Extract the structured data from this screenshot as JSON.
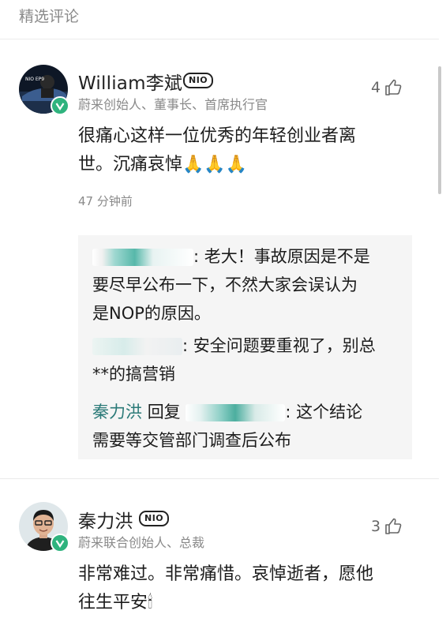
{
  "section_title": "精选评论",
  "comments": [
    {
      "username": "William李斌",
      "badge": "NIO",
      "title": "蔚来创始人、董事长、首席执行官",
      "likes": "4",
      "text_line1": "很痛心这样一位优秀的年轻创业者离",
      "text_line2": "世。沉痛哀悼🙏🙏🙏",
      "time": "47 分钟前",
      "replies": [
        {
          "text_line1": ": 老大！事故原因是不是",
          "text_line2": "要尽早公布一下，不然大家会误认为",
          "text_line3": "是NOP的原因。"
        },
        {
          "text_line1": ": 安全问题要重视了，别总",
          "text_line2": "**的搞营销"
        },
        {
          "name": "秦力洪",
          "verb": "回复",
          "text_line1": ": 这个结论",
          "text_line2": "需要等交管部门调查后公布"
        }
      ]
    },
    {
      "username": "秦力洪",
      "badge": "NIO",
      "title": "蔚来联合创始人、总裁",
      "likes": "3",
      "text_line1": "非常难过。非常痛惜。哀悼逝者，愿他",
      "text_line2": "往生平安🕯"
    }
  ],
  "colors": {
    "verified": "#2fb37e",
    "reply_name": "#2b7a78",
    "reply_bg": "#f5f5f5",
    "muted": "#8a8a8a"
  }
}
